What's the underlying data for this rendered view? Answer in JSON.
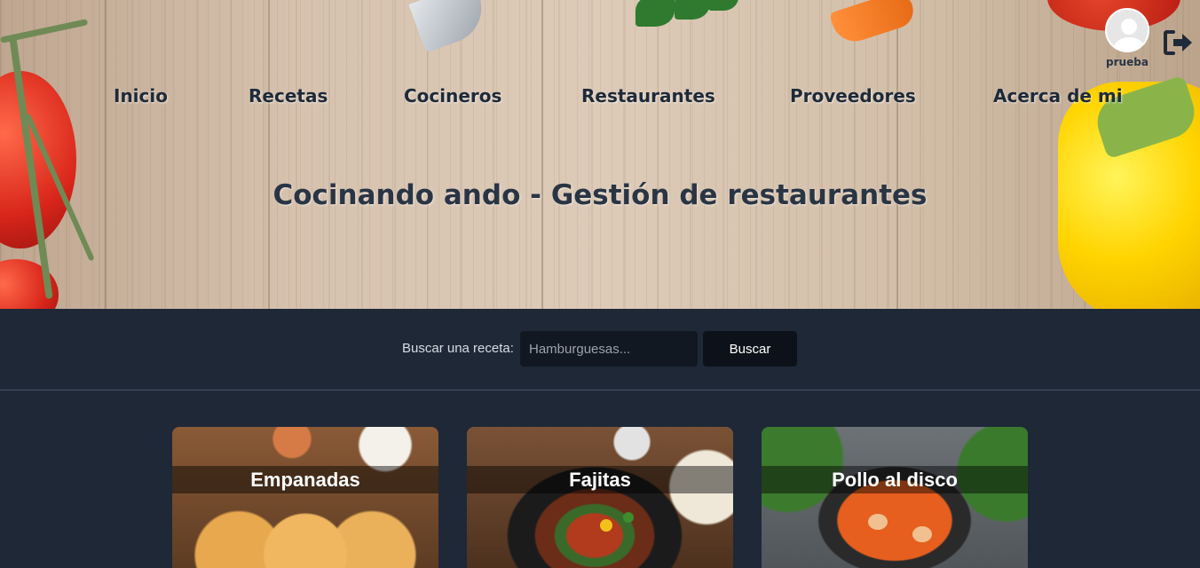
{
  "nav": {
    "items": [
      {
        "label": "Inicio"
      },
      {
        "label": "Recetas"
      },
      {
        "label": "Cocineros"
      },
      {
        "label": "Restaurantes"
      },
      {
        "label": "Proveedores"
      },
      {
        "label": "Acerca de mi"
      }
    ]
  },
  "hero": {
    "title": "Cocinando ando - Gestión de restaurantes"
  },
  "user": {
    "username": "prueba",
    "avatar_icon": "user-avatar-icon",
    "logout_icon": "logout-icon"
  },
  "search": {
    "label": "Buscar una receta:",
    "placeholder": "Hamburguesas...",
    "value": "",
    "button_label": "Buscar"
  },
  "recipes": [
    {
      "title": "Empanadas"
    },
    {
      "title": "Fajitas"
    },
    {
      "title": "Pollo al disco"
    }
  ],
  "colors": {
    "page_background": "#1e2837",
    "nav_text": "#1f2a38",
    "button_background": "#0d121a"
  }
}
